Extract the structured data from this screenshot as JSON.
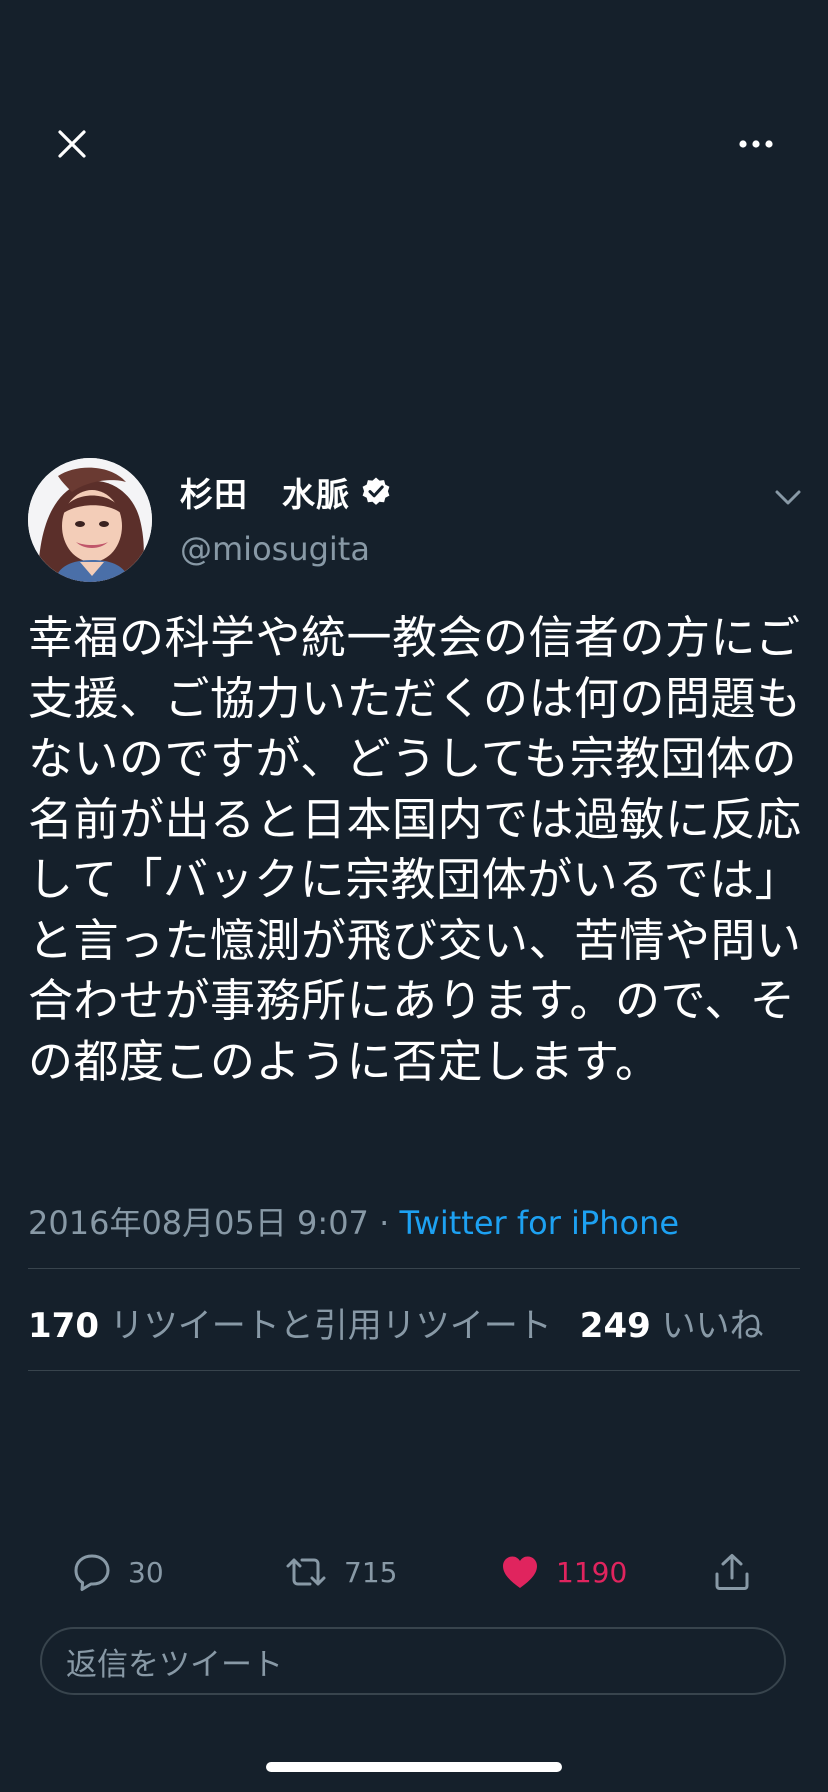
{
  "top_bar": {
    "close_icon": "close-icon",
    "more_icon": "more-horizontal-icon"
  },
  "author": {
    "display_name": "杉田　水脈",
    "handle": "@miosugita",
    "verified": true,
    "caret_icon": "chevron-down-icon"
  },
  "tweet": {
    "text": "幸福の科学や統一教会の信者の方にご支援、ご協力いただくのは何の問題もないのですが、どうしても宗教団体の名前が出ると日本国内では過敏に反応して「バックに宗教団体がいるでは」と言った憶測が飛び交い、苦情や問い合わせが事務所にあります。ので、その都度このように否定します。",
    "timestamp": "2016年08月05日 9:07",
    "separator": " · ",
    "source": "Twitter for iPhone"
  },
  "stats": {
    "retweets_count": "170",
    "retweets_label": "リツイートと引用リツイート",
    "likes_count": "249",
    "likes_label": "いいね"
  },
  "actions": {
    "reply_count": "30",
    "retweet_count": "715",
    "like_count": "1190",
    "liked": true,
    "share_icon": "share-icon"
  },
  "reply_box": {
    "placeholder": "返信をツイート"
  },
  "colors": {
    "background": "#15202b",
    "secondary_text": "#8899a6",
    "link": "#1da1f2",
    "like": "#e0245e",
    "divider": "#38444d"
  }
}
